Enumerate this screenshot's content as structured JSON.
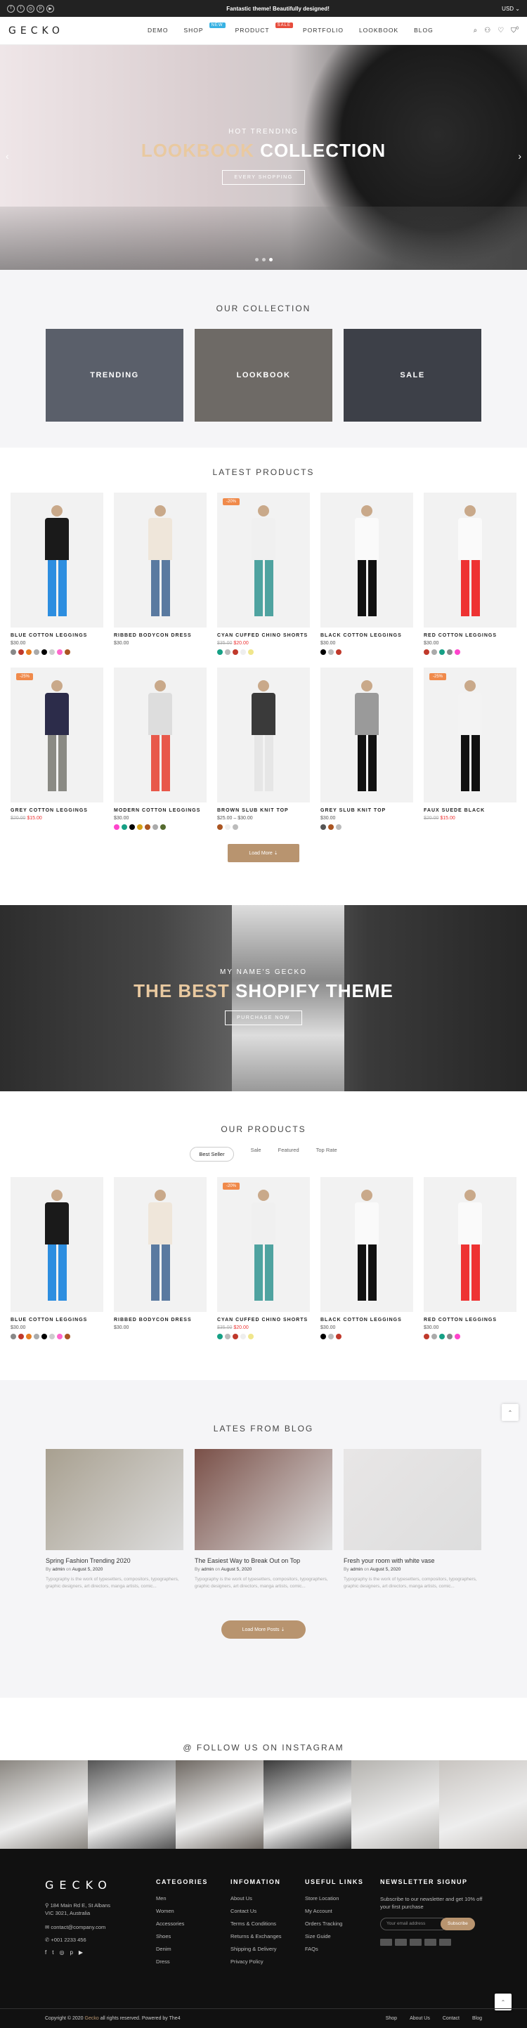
{
  "topbar": {
    "promo": "Fantastic theme! Beautifully designed!",
    "currency": "USD ⌄",
    "socials": [
      "f",
      "t",
      "◎",
      "p",
      "▶"
    ]
  },
  "header": {
    "logo": "GECKO",
    "nav": [
      {
        "label": "DEMO",
        "badge": "",
        "badge_color": ""
      },
      {
        "label": "SHOP",
        "badge": "NEW",
        "badge_color": "#39b2e3"
      },
      {
        "label": "PRODUCT",
        "badge": "SALE",
        "badge_color": "#e74c3c"
      },
      {
        "label": "PORTFOLIO",
        "badge": "",
        "badge_color": ""
      },
      {
        "label": "LOOKBOOK",
        "badge": "",
        "badge_color": ""
      },
      {
        "label": "BLOG",
        "badge": "",
        "badge_color": ""
      }
    ],
    "icons": [
      "search-icon",
      "user-icon",
      "heart-icon",
      "cart-icon"
    ],
    "cart_count": "0"
  },
  "hero": {
    "subtitle": "HOT TRENDING",
    "title_accent": "LOOKBOOK",
    "title_rest": " COLLECTION",
    "button": "EVERY SHOPPING",
    "slides": 3,
    "active_slide": 2
  },
  "collection": {
    "title": "OUR COLLECTION",
    "items": [
      {
        "label": "TRENDING",
        "color": "#5a5f6a"
      },
      {
        "label": "LOOKBOOK",
        "color": "#6e6a66"
      },
      {
        "label": "SALE",
        "color": "#3d4048"
      }
    ]
  },
  "latest": {
    "title": "LATEST PRODUCTS",
    "rows": [
      [
        {
          "name": "BLUE COTTON LEGGINGS",
          "price": "$30.00",
          "old": "",
          "sale": "",
          "top": "#1a1a1a",
          "bottom": "#2d8ee0",
          "swatches": [
            "#888",
            "#c0392b",
            "#e67e22",
            "#aaa",
            "#000",
            "#ccc",
            "#f6c",
            "#a52"
          ]
        },
        {
          "name": "RIBBED BODYCON DRESS",
          "price": "$30.00",
          "old": "",
          "sale": "",
          "top": "#efe6da",
          "bottom": "#5a7aa0",
          "swatches": []
        },
        {
          "name": "CYAN CUFFED CHINO SHORTS",
          "price": "$20.00",
          "old": "$35.00",
          "sale": "-20%",
          "top": "#f0f0f0",
          "bottom": "#4fa3a0",
          "swatches": [
            "#16a085",
            "#bbb",
            "#c0392b",
            "#eee",
            "#f0e68c"
          ]
        },
        {
          "name": "BLACK COTTON LEGGINGS",
          "price": "$30.00",
          "old": "",
          "sale": "",
          "top": "#fafafa",
          "bottom": "#111",
          "swatches": [
            "#000",
            "#bbb",
            "#c0392b"
          ]
        },
        {
          "name": "RED COTTON LEGGINGS",
          "price": "$30.00",
          "old": "",
          "sale": "",
          "top": "#fafafa",
          "bottom": "#e33",
          "swatches": [
            "#c0392b",
            "#aaa",
            "#16a085",
            "#888",
            "#f4c"
          ]
        }
      ],
      [
        {
          "name": "GREY COTTON LEGGINGS",
          "price": "$15.00",
          "old": "$20.00",
          "sale": "-25%",
          "top": "#2c2c4a",
          "bottom": "#8a8a84",
          "swatches": []
        },
        {
          "name": "MODERN COTTON LEGGINGS",
          "price": "$30.00",
          "old": "",
          "sale": "",
          "top": "#ddd",
          "bottom": "#e8584a",
          "swatches": [
            "#f4c",
            "#16a085",
            "#000",
            "#d4a017",
            "#a52",
            "#aaa",
            "#556b2f"
          ]
        },
        {
          "name": "BROWN SLUB KNIT TOP",
          "price": "$25.00 – $30.00",
          "old": "",
          "sale": "",
          "top": "#3a3a3a",
          "bottom": "#e6e6e6",
          "swatches": [
            "#a52",
            "#eee",
            "#bbb"
          ]
        },
        {
          "name": "GREY SLUB KNIT TOP",
          "price": "$30.00",
          "old": "",
          "sale": "",
          "top": "#9a9a9a",
          "bottom": "#111",
          "swatches": [
            "#555",
            "#a52",
            "#bbb"
          ]
        },
        {
          "name": "FAUX SUEDE BLACK",
          "price": "$15.00",
          "old": "$20.00",
          "sale": "-25%",
          "top": "#f3f3f3",
          "bottom": "#111",
          "swatches": []
        }
      ]
    ],
    "load_more": "Load More ⇣"
  },
  "banner": {
    "subtitle": "MY NAME'S GECKO",
    "title_accent": "THE BEST",
    "title_rest": " SHOPIFY THEME",
    "button": "PURCHASE NOW"
  },
  "our_products": {
    "title": "OUR PRODUCTS",
    "tabs": [
      "Best Seller",
      "Sale",
      "Featured",
      "Top Rate"
    ],
    "active_tab": 0
  },
  "blog": {
    "title": "LATES FROM BLOG",
    "posts": [
      {
        "title": "Spring Fashion Trending 2020",
        "by": "By",
        "author": "admin",
        "on": "on",
        "date": "August 5, 2020",
        "excerpt": "Typography is the work of typesetters, compositors, typographers, graphic designers, art directors, manga artists, comic...",
        "color": "#a8a090"
      },
      {
        "title": "The Easiest Way to Break Out on Top",
        "by": "By",
        "author": "admin",
        "on": "on",
        "date": "August 5, 2020",
        "excerpt": "Typography is the work of typesetters, compositors, typographers, graphic designers, art directors, manga artists, comic...",
        "color": "#7a5048"
      },
      {
        "title": "Fresh your room with white vase",
        "by": "By",
        "author": "admin",
        "on": "on",
        "date": "August 5, 2020",
        "excerpt": "Typography is the work of typesetters, compositors, typographers, graphic designers, art directors, manga artists, comic...",
        "color": "#e8e6e6"
      }
    ],
    "load_more": "Load More Posts ⇣"
  },
  "instagram": {
    "title": "@ FOLLOW US ON INSTAGRAM",
    "tiles": [
      "#8a8680",
      "#555",
      "#6e6862",
      "#3a3a3a",
      "#b4b2ae",
      "#c8c4c0"
    ]
  },
  "footer": {
    "logo": "GECKO",
    "address": "184 Main Rd E, St Albans VIC 3021, Australia",
    "email": "contact@company.com",
    "phone": "+001 2233 456",
    "columns": [
      {
        "head": "CATEGORIES",
        "links": [
          "Men",
          "Women",
          "Accessories",
          "Shoes",
          "Denim",
          "Dress"
        ]
      },
      {
        "head": "INFOMATION",
        "links": [
          "About Us",
          "Contact Us",
          "Terms & Conditions",
          "Returns & Exchanges",
          "Shipping & Delivery",
          "Privacy Policy"
        ]
      },
      {
        "head": "USEFUL LINKS",
        "links": [
          "Store Location",
          "My Account",
          "Orders Tracking",
          "Size Guide",
          "FAQs"
        ]
      }
    ],
    "newsletter": {
      "head": "NEWSLETTER SIGNUP",
      "text": "Subscribe to our newsletter and get 10% off your first purchase",
      "placeholder": "Your email address",
      "button": "Subscribe"
    },
    "copyright_pre": "Copyright © 2020 ",
    "copyright_brand": "Gecko",
    "copyright_post": " all rights reserved. Powered by The4",
    "bottom_links": [
      "Shop",
      "About Us",
      "Contact",
      "Blog"
    ]
  }
}
